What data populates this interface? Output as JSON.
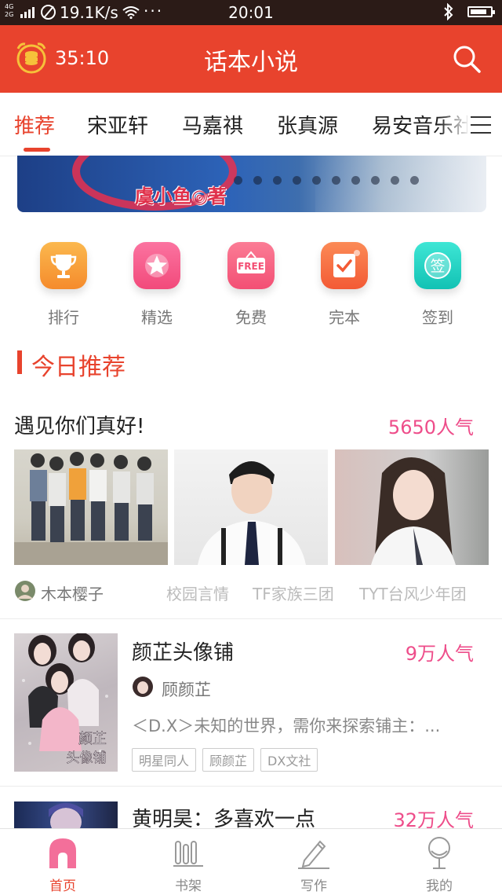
{
  "status": {
    "network": "4G\n2G",
    "speed": "19.1K/s",
    "more": "···",
    "time": "20:01"
  },
  "header": {
    "timer": "35:10",
    "title": "话本小说"
  },
  "tabs": [
    {
      "label": "推荐"
    },
    {
      "label": "宋亚轩"
    },
    {
      "label": "马嘉祺"
    },
    {
      "label": "张真源"
    },
    {
      "label": "易安音乐社"
    }
  ],
  "banner": {
    "author": "虞小鱼◎著"
  },
  "quick_menu": [
    {
      "label": "排行",
      "icon": "trophy-icon",
      "color": "#f8a23a"
    },
    {
      "label": "精选",
      "icon": "star-icon",
      "color": "#f45487"
    },
    {
      "label": "免费",
      "icon": "free-sign-icon",
      "color": "#f55a7e"
    },
    {
      "label": "完本",
      "icon": "check-book-icon",
      "color": "#f7643c"
    },
    {
      "label": "签到",
      "icon": "sign-in-icon",
      "color": "#23d3c5"
    }
  ],
  "section": {
    "title": "今日推荐"
  },
  "featured": {
    "title": "遇见你们真好!",
    "popularity": "5650人气",
    "author": "木本樱子",
    "tags": [
      "校园言情",
      "TF家族三团",
      "TYT台风少年团"
    ]
  },
  "books": [
    {
      "title": "颜芷头像铺",
      "popularity": "9万人气",
      "author": "顾颜芷",
      "desc": "＜D.X＞未知的世界，需你来探索铺主：...",
      "tags": [
        "明星同人",
        "顾颜芷",
        "DX文社"
      ],
      "cover_text": "颜芷\n头像铺"
    },
    {
      "title": "黄明昊：多喜欢一点",
      "popularity": "32万人气"
    }
  ],
  "bottom_nav": [
    {
      "label": "首页",
      "icon": "home-icon"
    },
    {
      "label": "书架",
      "icon": "bookshelf-icon"
    },
    {
      "label": "写作",
      "icon": "pen-icon"
    },
    {
      "label": "我的",
      "icon": "profile-icon"
    }
  ],
  "colors": {
    "brand": "#e8432d",
    "popularity": "#ee4d8a"
  }
}
